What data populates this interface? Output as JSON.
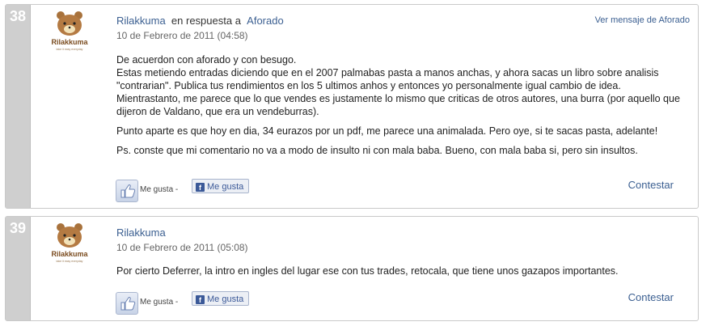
{
  "comments": [
    {
      "number": "38",
      "author": "Rilakkuma",
      "in_reply_text": "en respuesta a",
      "reply_to": "Aforado",
      "date": "10 de Febrero de 2011 (04:58)",
      "view_parent": "Ver mensaje de Aforado",
      "paragraphs": [
        "De acuerdon con aforado y con besugo.",
        "Estas metiendo entradas diciendo que en el 2007 palmabas pasta a manos anchas, y ahora sacas un libro sobre analisis \"contrarian\". Publica tus rendimientos en los 5 ultimos anhos y entonces yo personalmente igual cambio de idea.",
        "Mientrastanto, me parece que lo que vendes es justamente lo mismo que criticas de otros autores, una burra (por aquello que dijeron de Valdano, que era un vendeburras).",
        "Punto aparte es que hoy en dia, 34 eurazos por un pdf, me parece una animalada. Pero oye, si te sacas pasta, adelante!",
        "Ps. conste que mi comentario no va a modo de insulto ni con mala baba. Bueno, con mala baba si, pero sin insultos."
      ],
      "like_text": "Me gusta",
      "fb_label": "Me gusta",
      "reply_label": "Contestar"
    },
    {
      "number": "39",
      "author": "Rilakkuma",
      "date": "10 de Febrero de 2011 (05:08)",
      "paragraphs": [
        "Por cierto Deferrer, la intro en ingles del lugar ese con tus trades, retocala, que tiene unos gazapos importantes."
      ],
      "like_text": "Me gusta",
      "fb_label": "Me gusta",
      "reply_label": "Contestar"
    }
  ],
  "avatar": {
    "brand": "Rilakkuma",
    "tagline": "take it easy everyday"
  },
  "colors": {
    "link": "#3b5f91",
    "number_bg": "#cfcfcf",
    "fb_blue": "#3b5998"
  },
  "icons": {
    "like": "thumbs-up-icon",
    "facebook": "facebook-icon"
  }
}
